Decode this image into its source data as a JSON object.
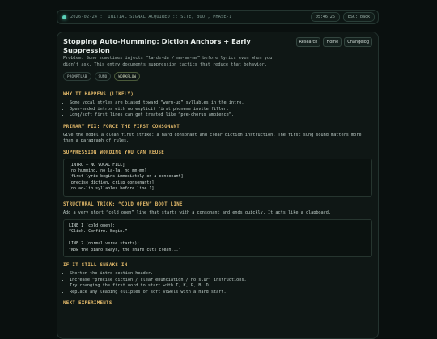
{
  "status": {
    "text": "2026-02-24 :: INITIAL SIGNAL ACQUIRED :: SITE, BOOT, PHASE-1",
    "time": "05:46:26",
    "esc_label": "ESC: back"
  },
  "article": {
    "title": "Stopping Auto-Humming: Diction Anchors + Early Suppression",
    "nav": [
      "Research",
      "Home",
      "Changelog"
    ],
    "description": "Problem: Suno sometimes injects “la-de-da / mm-mm-mm” before lyrics even when you didn't ask. This entry documents suppression tactics that reduce that behavior.",
    "tags": [
      "PROMPTLAB",
      "SUNO",
      "WORKFLOW"
    ]
  },
  "sections": {
    "why": {
      "heading": "WHY IT HAPPENS (LIKELY)",
      "bullets": [
        "Some vocal styles are biased toward “warm-up” syllables in the intro.",
        "Open-ended intros with no explicit first phoneme invite filler.",
        "Long/soft first lines can get treated like “pre-chorus ambience”."
      ]
    },
    "primary": {
      "heading": "PRIMARY FIX: FORCE THE FIRST CONSONANT",
      "body": "Give the model a clean first strike: a hard consonant and clear diction instruction. The first sung sound matters more than a paragraph of rules."
    },
    "wording": {
      "heading": "SUPPRESSION WORDING YOU CAN REUSE",
      "lines": [
        "[INTRO — NO VOCAL FILL]",
        "[no humming, no la-la, no mm-mm]",
        "[first lyric begins immediately on a consonant]",
        "[precise diction, crisp consonants]",
        "[no ad-lib syllables before line 1]"
      ]
    },
    "coldopen": {
      "heading": "STRUCTURAL TRICK: “COLD OPEN” BOOT LINE",
      "body": "Add a very short “cold open” line that starts with a consonant and ends quickly. It acts like a clapboard.",
      "lines": [
        "LINE 1 (cold open):",
        "“Click. Confirm. Begin.”",
        "",
        "LINE 2 (normal verse starts):",
        "“Now the piano sways, the snare cuts clean...”"
      ]
    },
    "still": {
      "heading": "IF IT STILL SNEAKS IN",
      "bullets": [
        "Shorten the intro section header.",
        "Increase “precise diction / clear enunciation / no slur” instructions.",
        "Try changing the first word to start with T, K, P, B, D.",
        "Replace any leading ellipses or soft vowels with a hard start."
      ]
    },
    "next": {
      "heading": "NEXT EXPERIMENTS"
    }
  }
}
